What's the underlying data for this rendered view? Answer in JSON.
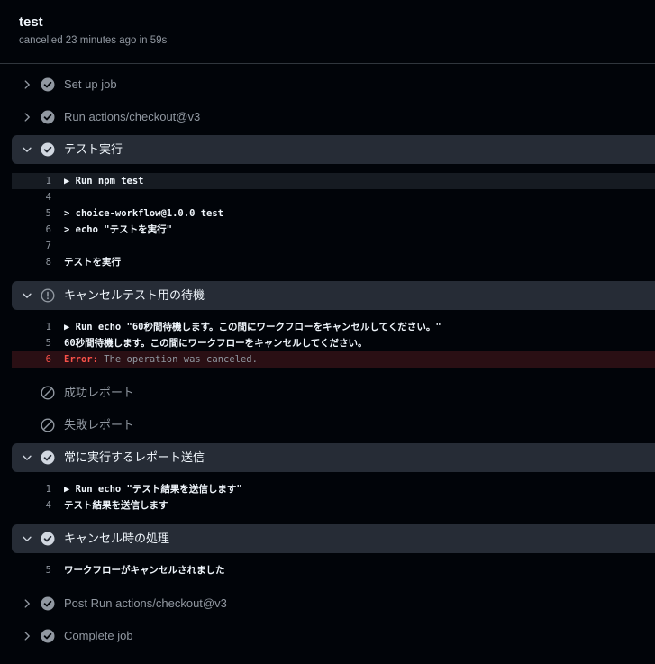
{
  "job": {
    "title": "test",
    "subtitle": "cancelled 23 minutes ago in 59s"
  },
  "steps": [
    {
      "name": "Set up job",
      "status": "success",
      "expanded": false
    },
    {
      "name": "Run actions/checkout@v3",
      "status": "success",
      "expanded": false
    },
    {
      "name": "テスト実行",
      "status": "success",
      "expanded": true
    },
    {
      "name": "キャンセルテスト用の待機",
      "status": "cancelled",
      "expanded": true
    },
    {
      "name": "成功レポート",
      "status": "skipped",
      "expanded": false
    },
    {
      "name": "失敗レポート",
      "status": "skipped",
      "expanded": false
    },
    {
      "name": "常に実行するレポート送信",
      "status": "success",
      "expanded": true
    },
    {
      "name": "キャンセル時の処理",
      "status": "success",
      "expanded": true
    },
    {
      "name": "Post Run actions/checkout@v3",
      "status": "success",
      "expanded": false
    },
    {
      "name": "Complete job",
      "status": "success",
      "expanded": false
    }
  ],
  "logs": {
    "test_run": [
      {
        "num": "1",
        "text": "▶ Run npm test"
      },
      {
        "num": "4",
        "text": ""
      },
      {
        "num": "5",
        "text": "> choice-workflow@1.0.0 test"
      },
      {
        "num": "6",
        "text": "> echo \"テストを実行\""
      },
      {
        "num": "7",
        "text": ""
      },
      {
        "num": "8",
        "text": "テストを実行"
      }
    ],
    "cancel_wait": [
      {
        "num": "1",
        "text": "▶ Run echo \"60秒間待機します。この間にワークフローをキャンセルしてください。\""
      },
      {
        "num": "5",
        "text": "60秒間待機します。この間にワークフローをキャンセルしてください。"
      },
      {
        "num": "6",
        "error_label": "Error:",
        "error_text": " The operation was canceled."
      }
    ],
    "always_report": [
      {
        "num": "1",
        "text": "▶ Run echo \"テスト結果を送信します\""
      },
      {
        "num": "4",
        "text": "テスト結果を送信します"
      }
    ],
    "on_cancel": [
      {
        "num": "5",
        "text": "ワークフローがキャンセルされました"
      }
    ]
  },
  "colors": {
    "success_icon": "#d1d7e0",
    "collapsed_icon": "#9198a1",
    "error": "#f85149",
    "expanded_bg": "#262c36"
  },
  "icons": {
    "chevron_collapsed": "chevron-right-icon",
    "chevron_expanded": "chevron-down-icon",
    "success": "check-circle-icon",
    "cancelled": "alert-circle-icon",
    "skipped": "skip-icon"
  }
}
